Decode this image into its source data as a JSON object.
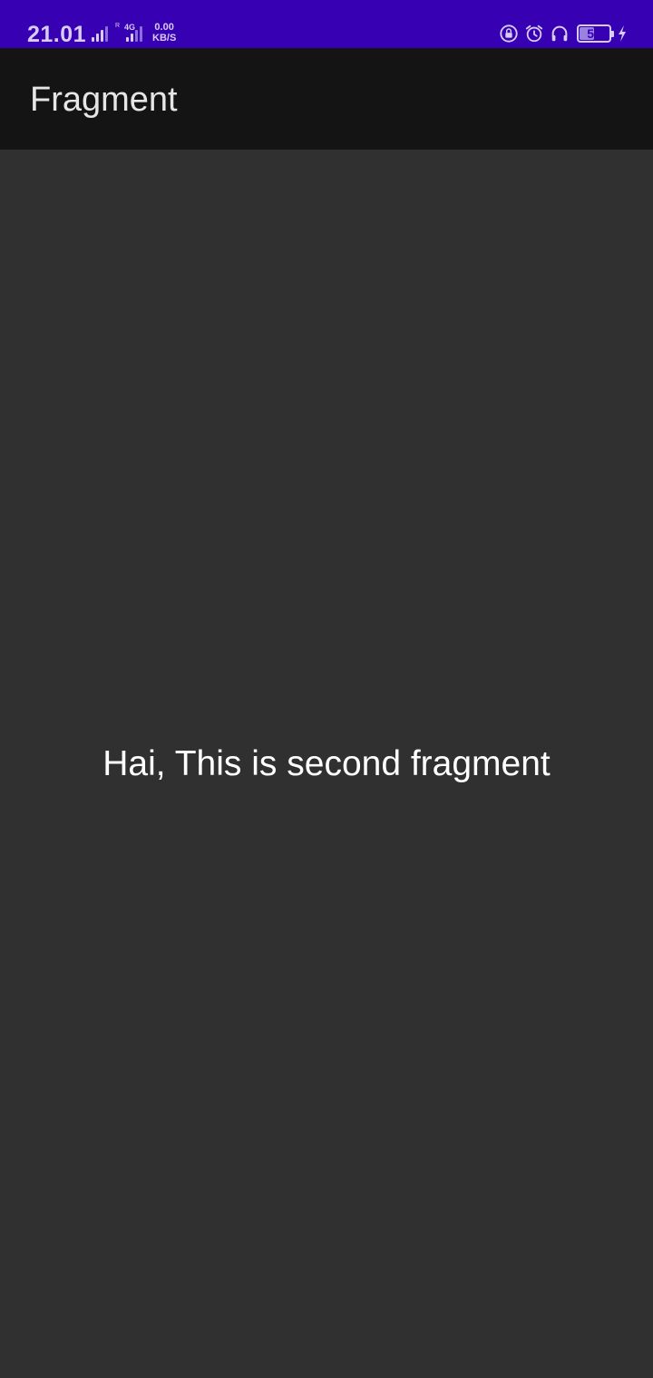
{
  "status_bar": {
    "time": "21.01",
    "network_type": "4G",
    "network_secondary": "R",
    "speed_value": "0.00",
    "speed_unit": "KB/S",
    "battery_level": "54",
    "battery_fraction": 0.54,
    "icons": [
      "signal-icon",
      "signal-icon",
      "rotation-lock-icon",
      "alarm-icon",
      "headphones-icon",
      "battery-icon",
      "charging-icon"
    ],
    "color": "#3700b3"
  },
  "app_bar": {
    "title": "Fragment",
    "color": "#141414"
  },
  "content": {
    "message": "Hai, This is second fragment",
    "background": "#303030"
  }
}
